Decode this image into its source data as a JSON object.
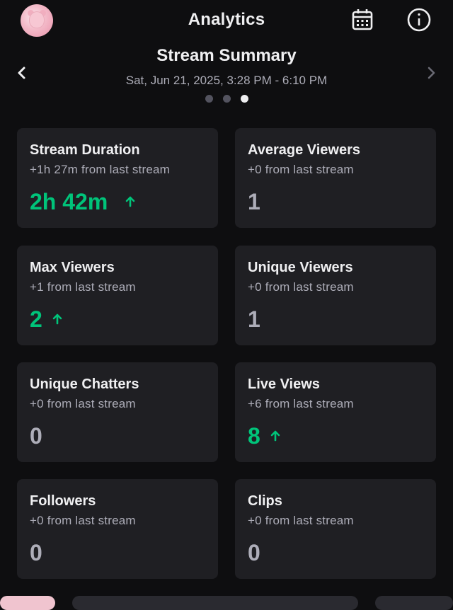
{
  "header": {
    "title": "Analytics",
    "avatar_icon": "avatar-image",
    "calendar_icon": "calendar-icon",
    "info_icon": "info-icon"
  },
  "summary": {
    "title": "Stream Summary",
    "date_range": "Sat, Jun 21, 2025, 3:28 PM - 6:10 PM",
    "pages": 3,
    "active_page": 3
  },
  "colors": {
    "background": "#0e0e10",
    "card": "#1f1f23",
    "positive": "#00c47a",
    "muted": "#adadb8"
  },
  "stats": [
    {
      "title": "Stream Duration",
      "delta": "+1h 27m from last stream",
      "value": "2h 42m",
      "trend": "up"
    },
    {
      "title": "Average Viewers",
      "delta": "+0 from last stream",
      "value": "1",
      "trend": "none"
    },
    {
      "title": "Max Viewers",
      "delta": "+1 from last stream",
      "value": "2",
      "trend": "up"
    },
    {
      "title": "Unique Viewers",
      "delta": "+0 from last stream",
      "value": "1",
      "trend": "none"
    },
    {
      "title": "Unique Chatters",
      "delta": "+0 from last stream",
      "value": "0",
      "trend": "none"
    },
    {
      "title": "Live Views",
      "delta": "+6 from last stream",
      "value": "8",
      "trend": "up"
    },
    {
      "title": "Followers",
      "delta": "+0 from last stream",
      "value": "0",
      "trend": "none"
    },
    {
      "title": "Clips",
      "delta": "+0 from last stream",
      "value": "0",
      "trend": "none"
    }
  ]
}
